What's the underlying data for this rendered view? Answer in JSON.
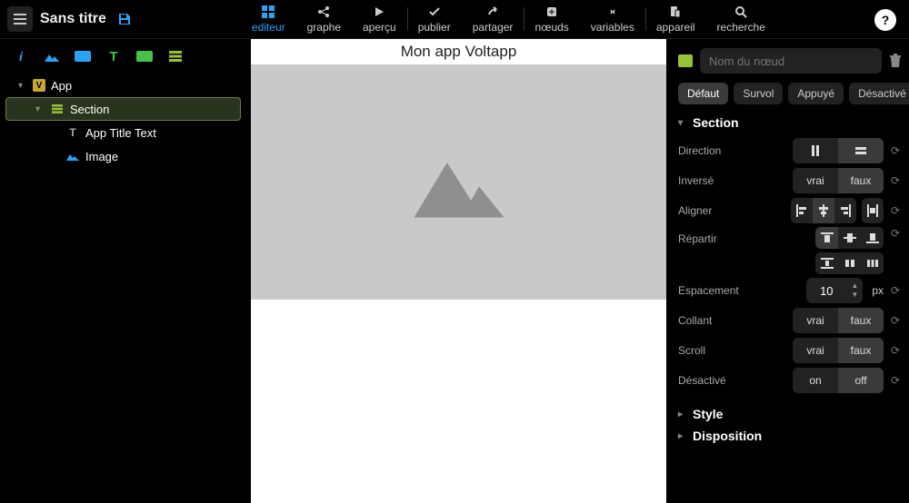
{
  "header": {
    "title": "Sans titre",
    "tabs": [
      {
        "label": "editeur"
      },
      {
        "label": "graphe"
      },
      {
        "label": "aperçu"
      },
      {
        "label": "publier"
      },
      {
        "label": "partager"
      },
      {
        "label": "nœuds"
      },
      {
        "label": "variables"
      },
      {
        "label": "appareil"
      },
      {
        "label": "recherche"
      }
    ],
    "help": "?"
  },
  "left": {
    "tool_icons": [
      "info",
      "image",
      "rect",
      "text",
      "container",
      "section"
    ],
    "tree": {
      "app": "App",
      "section": "Section",
      "title_text": "App Title Text",
      "image": "Image"
    }
  },
  "canvas": {
    "app_title": "Mon app Voltapp"
  },
  "right": {
    "name_placeholder": "Nom du nœud",
    "states": [
      "Défaut",
      "Survol",
      "Appuyé",
      "Désactivé"
    ],
    "active_state": 0,
    "section_heading": "Section",
    "props": {
      "direction": "Direction",
      "inverse": "Inversé",
      "aligner": "Aligner",
      "repartir": "Répartir",
      "espacement": "Espacement",
      "collant": "Collant",
      "scroll": "Scroll",
      "desactive": "Désactivé"
    },
    "values": {
      "inverse": [
        "vrai",
        "faux"
      ],
      "collant": [
        "vrai",
        "faux"
      ],
      "scroll": [
        "vrai",
        "faux"
      ],
      "desactive": [
        "on",
        "off"
      ],
      "espacement": "10",
      "espacement_unit": "px"
    },
    "style_heading": "Style",
    "disposition_heading": "Disposition"
  }
}
